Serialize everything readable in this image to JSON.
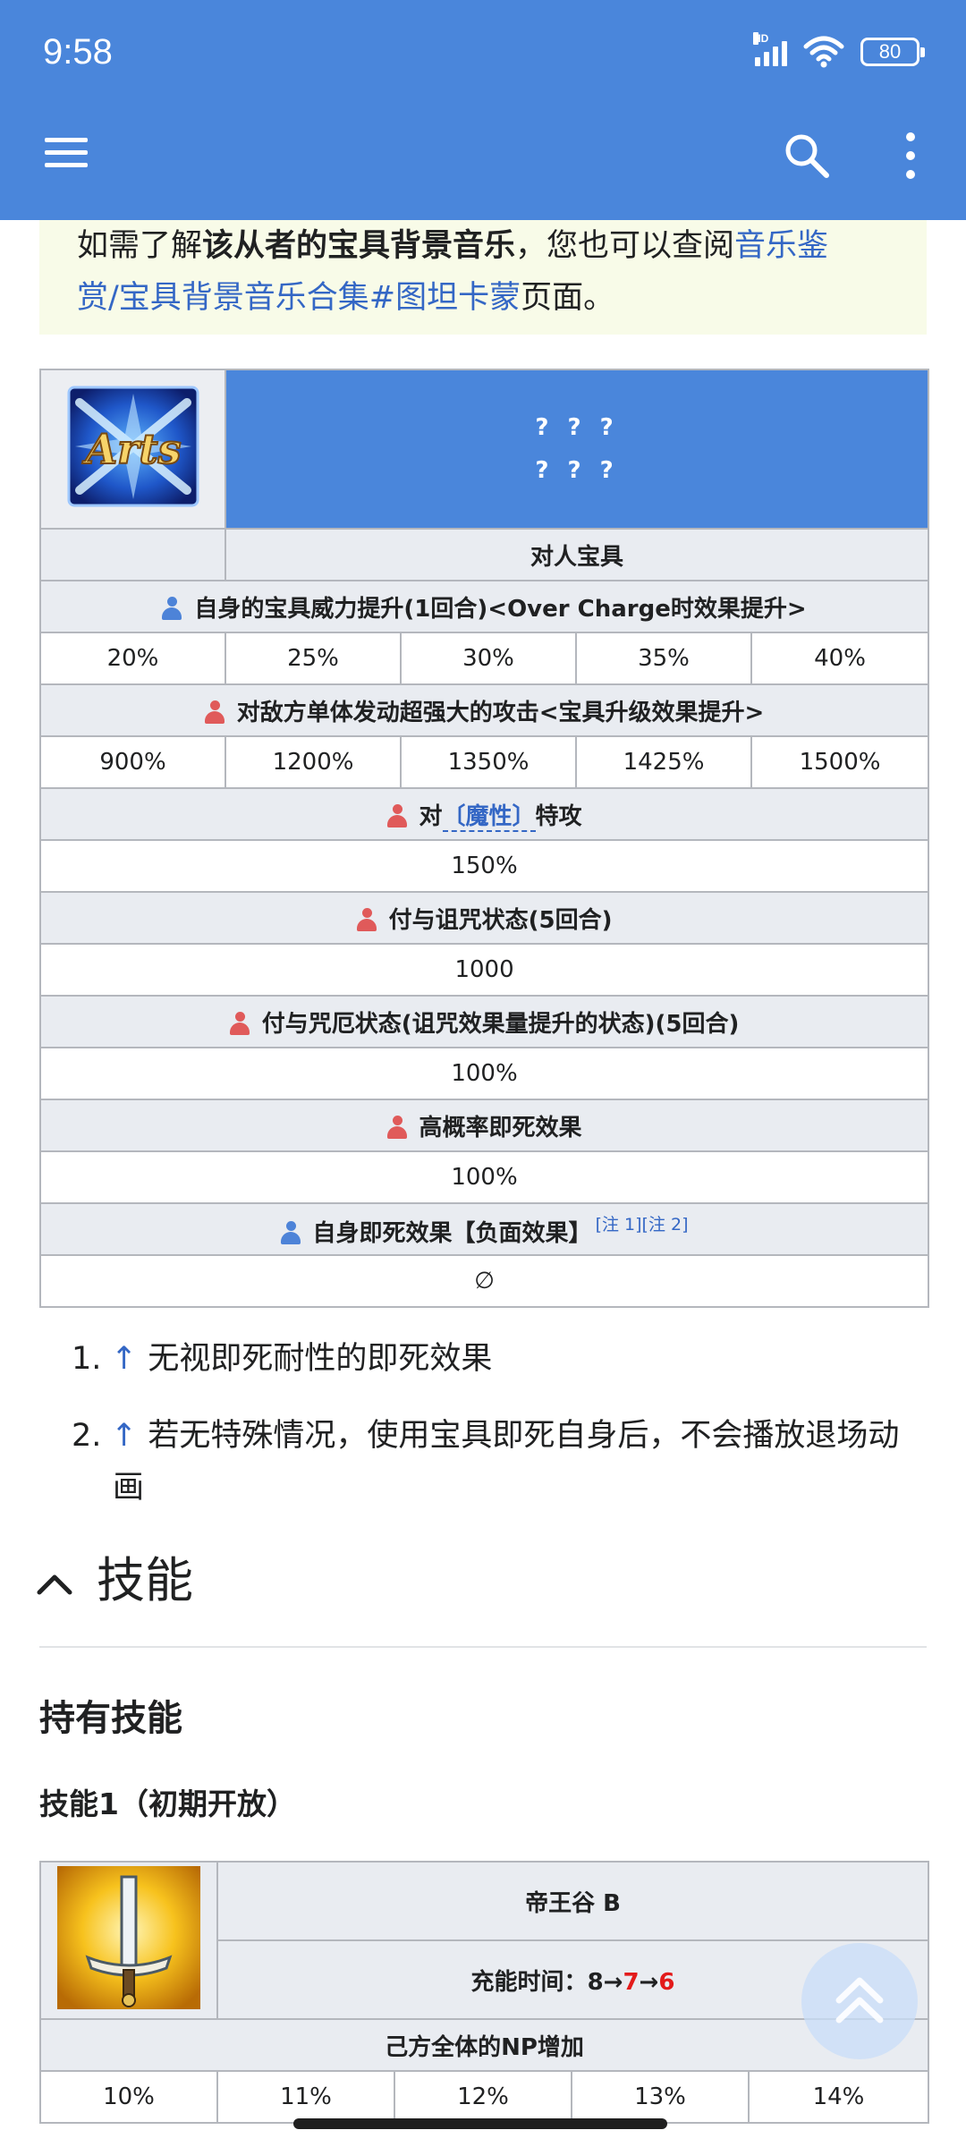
{
  "status_bar": {
    "time": "9:58",
    "network": "HD",
    "battery": "80"
  },
  "notice": {
    "prefix": "如需了解",
    "bold": "该从者的宝具背景音乐",
    "middle": "，您也可以查阅",
    "link_part1": "音乐鉴",
    "link_part2": "赏/宝具背景音乐合集#图坦卡蒙",
    "suffix": "页面。"
  },
  "np_table": {
    "card_icon": "arts-card-icon",
    "name_line1": "? ? ?",
    "name_line2": "? ? ?",
    "type": "对人宝具",
    "effects": [
      {
        "side": "self",
        "label": "自身的宝具威力提升(1回合)<Over Charge时效果提升>",
        "values": [
          "20%",
          "25%",
          "30%",
          "35%",
          "40%"
        ]
      },
      {
        "side": "enemy",
        "label": "对敌方单体发动超强大的攻击<宝具升级效果提升>",
        "values": [
          "900%",
          "1200%",
          "1350%",
          "1425%",
          "1500%"
        ]
      },
      {
        "side": "enemy",
        "label_prefix": "对",
        "trait": "〔魔性〕",
        "label_suffix": "特攻",
        "value": "150%"
      },
      {
        "side": "enemy",
        "label": "付与诅咒状态(5回合)",
        "value": "1000"
      },
      {
        "side": "enemy",
        "label": "付与咒厄状态(诅咒效果量提升的状态)(5回合)",
        "value": "100%"
      },
      {
        "side": "enemy",
        "label": "高概率即死效果",
        "value": "100%"
      },
      {
        "side": "self",
        "label": "自身即死效果【负面效果】",
        "note1": "[注 1]",
        "note2": "[注 2]",
        "value": "∅"
      }
    ]
  },
  "notes": [
    {
      "num": "1.",
      "arrow": "↑",
      "text": "无视即死耐性的即死效果"
    },
    {
      "num": "2.",
      "arrow": "↑",
      "text_line1": "若无特殊情况，使用宝具即死自身后，不会播放退场动",
      "text_line2": "画"
    }
  ],
  "section": {
    "title": "技能"
  },
  "skills": {
    "heading": "持有技能",
    "skill1_heading": "技能1（初期开放）",
    "skill1": {
      "icon": "sword-skill-icon",
      "name": "帝王谷 B",
      "cooldown_label": "充能时间：",
      "cooldown_start": "8",
      "arrow1": "→",
      "cooldown_mid": "7",
      "arrow2": "→",
      "cooldown_end": "6",
      "effect": "己方全体的NP增加",
      "values": [
        "10%",
        "11%",
        "12%",
        "13%",
        "14%"
      ]
    }
  }
}
